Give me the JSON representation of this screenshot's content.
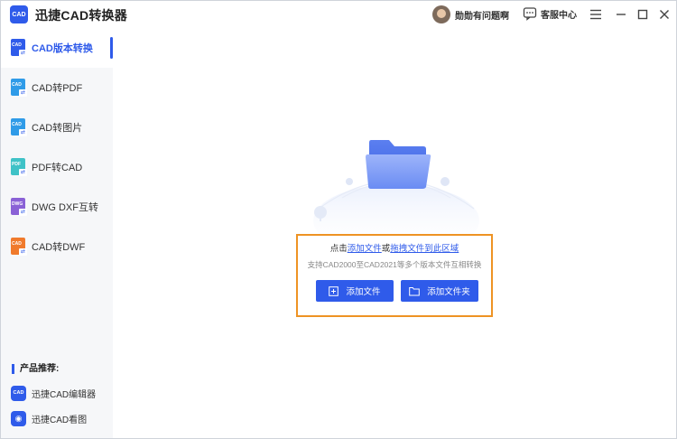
{
  "app": {
    "logo_text": "CAD",
    "title": "迅捷CAD转换器"
  },
  "header": {
    "user_name": "勋勋有问题啊",
    "support_label": "客服中心"
  },
  "sidebar": {
    "items": [
      {
        "label": "CAD版本转换",
        "icon_tag": "CAD",
        "icon_color": "#2f5bea"
      },
      {
        "label": "CAD转PDF",
        "icon_tag": "CAD",
        "icon_color": "#2f9be8"
      },
      {
        "label": "CAD转图片",
        "icon_tag": "CAD",
        "icon_color": "#2f9be8"
      },
      {
        "label": "PDF转CAD",
        "icon_tag": "PDF",
        "icon_color": "#3fc2c7"
      },
      {
        "label": "DWG DXF互转",
        "icon_tag": "DWG",
        "icon_color": "#8a61d6"
      },
      {
        "label": "CAD转DWF",
        "icon_tag": "CAD",
        "icon_color": "#f07a2c"
      }
    ],
    "recommend_title": "产品推荐:",
    "recommend": [
      {
        "label": "迅捷CAD编辑器",
        "icon_tag": "CAD"
      },
      {
        "label": "迅捷CAD看图",
        "icon_tag": "CAD"
      }
    ]
  },
  "main": {
    "hint_prefix": "点击",
    "hint_link1": "添加文件",
    "hint_or": "或",
    "hint_link2": "拖拽文件到此区域",
    "support_text": "支持CAD2000至CAD2021等多个版本文件互相转换",
    "add_file_label": "添加文件",
    "add_folder_label": "添加文件夹"
  },
  "colors": {
    "accent": "#2f5bea",
    "drop_border": "#ee9324"
  }
}
